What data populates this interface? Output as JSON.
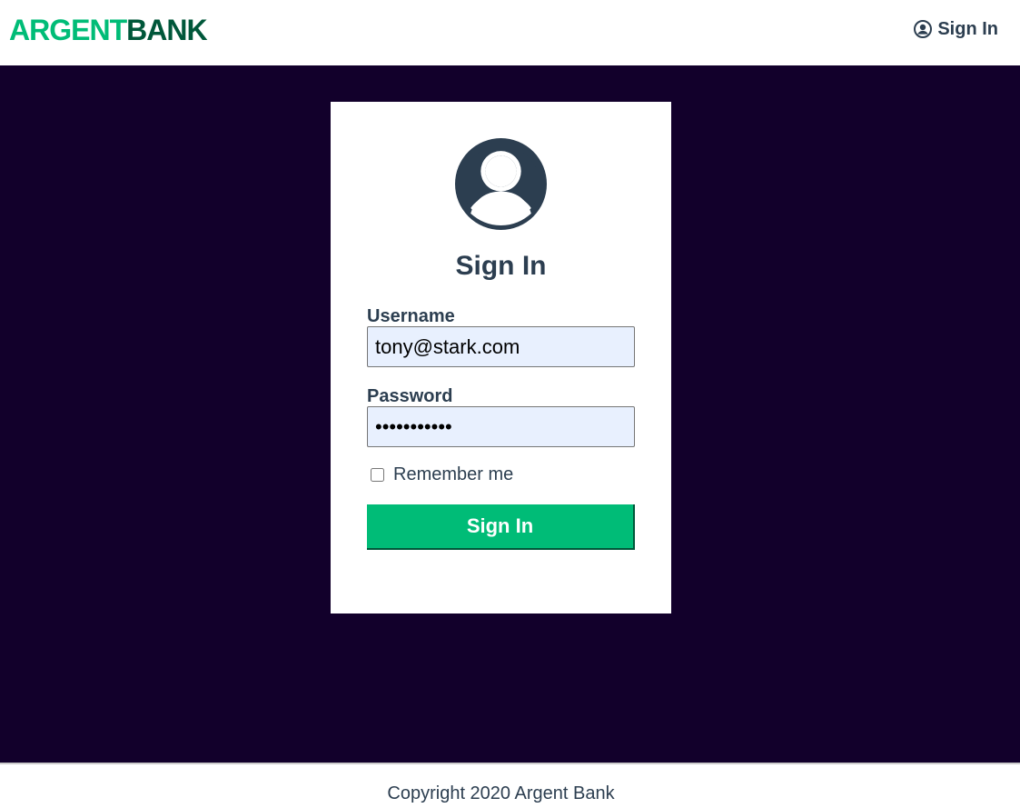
{
  "header": {
    "logo_part1": "ARGENT",
    "logo_part2": "BANK",
    "nav_signin_label": "Sign In",
    "nav_signin_icon": "user-circle-icon"
  },
  "login": {
    "avatar_icon": "user-circle-icon",
    "title": "Sign In",
    "username_label": "Username",
    "username_value": "tony@stark.com",
    "password_label": "Password",
    "password_value": "password123",
    "remember_label": "Remember me",
    "remember_checked": false,
    "submit_label": "Sign In"
  },
  "footer": {
    "copyright": "Copyright 2020 Argent Bank"
  },
  "colors": {
    "brand_green": "#00bc77",
    "brand_dark_green": "#00573a",
    "main_background": "#12002b",
    "text_primary": "#2c3e50",
    "input_autofill": "#e8f0fe"
  }
}
